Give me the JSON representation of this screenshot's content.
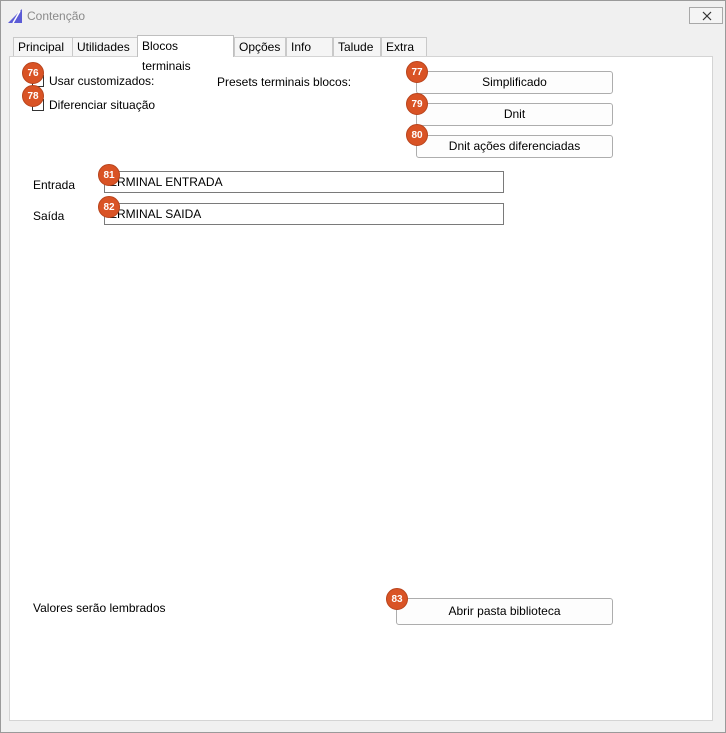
{
  "window": {
    "title": "Contenção",
    "app_icon": "sail-triangle-icon",
    "accent": "#5b5bd6"
  },
  "tabs": [
    {
      "label": "Principal"
    },
    {
      "label": "Utilidades"
    },
    {
      "label": "Blocos terminais",
      "active": true
    },
    {
      "label": "Opções"
    },
    {
      "label": "Info"
    },
    {
      "label": "Talude"
    },
    {
      "label": "Extra"
    }
  ],
  "options": {
    "usar_customizados": {
      "label": "Usar customizados:",
      "checked": false,
      "badge": "76"
    },
    "diferenciar_situacao": {
      "label": "Diferenciar situação",
      "checked": false,
      "badge": "78"
    }
  },
  "presets": {
    "label": "Presets terminais blocos:",
    "buttons": [
      {
        "label": "Simplificado",
        "badge": "77"
      },
      {
        "label": "Dnit",
        "badge": "79"
      },
      {
        "label": "Dnit ações diferenciadas",
        "badge": "80"
      }
    ]
  },
  "fields": {
    "entrada": {
      "label": "Entrada",
      "value": "ERMINAL ENTRADA",
      "badge": "81"
    },
    "saida": {
      "label": "Saída",
      "value": "ERMINAL SAIDA",
      "badge": "82"
    }
  },
  "footer": {
    "note": "Valores serão lembrados",
    "open_button": {
      "label": "Abrir pasta biblioteca",
      "badge": "83"
    }
  },
  "colors": {
    "badge": "#d95325"
  }
}
